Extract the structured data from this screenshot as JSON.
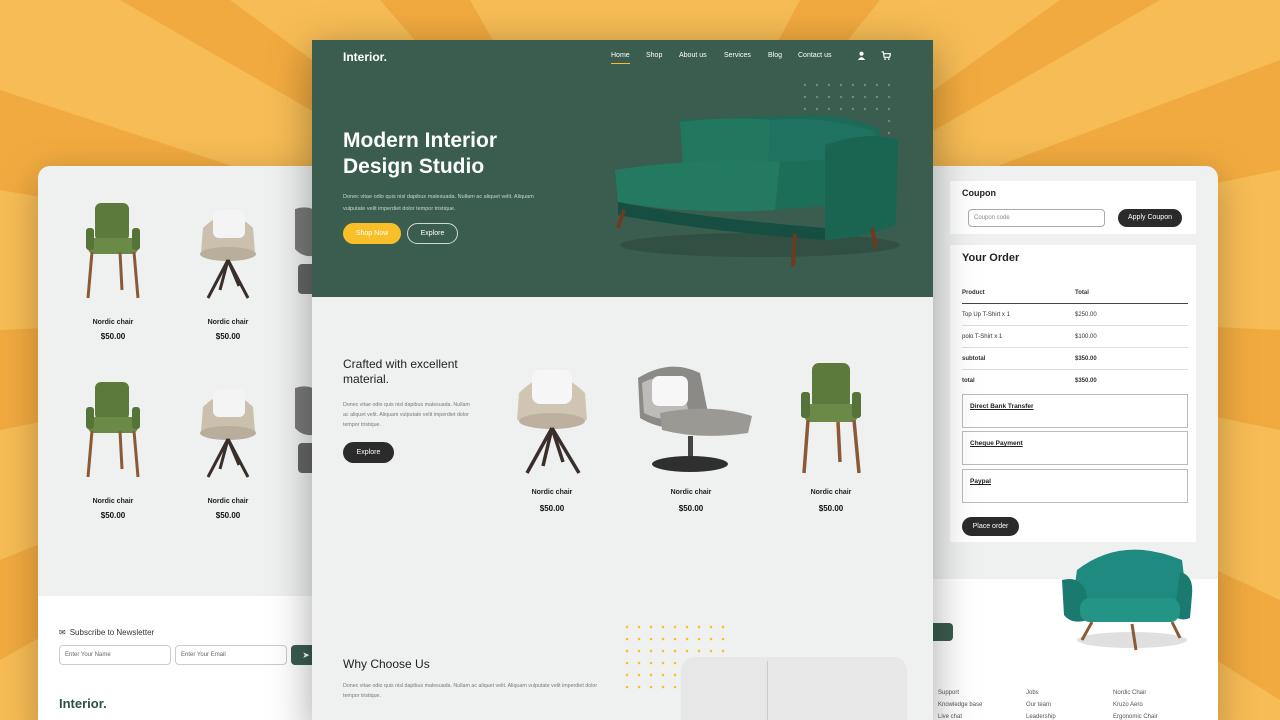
{
  "center": {
    "brand": "Interior.",
    "nav": [
      "Home",
      "Shop",
      "About us",
      "Services",
      "Blog",
      "Contact us"
    ],
    "nav_icons": [
      "user-icon",
      "cart-icon"
    ],
    "hero": {
      "title_line1": "Modern Interior",
      "title_line2": "Design Studio",
      "description_line1": "Donec vitae odio quis nisl dapibus malesuada. Nullam ac aliquet velit. Aliquam",
      "description_line2": "vulputate velit imperdiet dolor tempor tristique.",
      "primary_button": "Shop Now",
      "secondary_button": "Explore"
    },
    "crafted": {
      "title": "Crafted with excellent material.",
      "description": "Donec vitae odio quis nisl dapibus malesuada. Nullam ac aliquet velit. Aliquam vulputate velit imperdiet dolor tempor tristique.",
      "button": "Explore",
      "products": [
        {
          "name": "Nordic chair",
          "price": "$50.00"
        },
        {
          "name": "Nordic chair",
          "price": "$50.00"
        },
        {
          "name": "Nordic chair",
          "price": "$50.00"
        }
      ]
    },
    "why": {
      "title": "Why Choose Us",
      "description": "Donec vitae odio quis nisl dapibus malesuada. Nullam ac aliquet velit. Aliquam vulputate velit imperdiet dolor tempor tristique."
    }
  },
  "left": {
    "products": [
      {
        "name": "Nordic chair",
        "price": "$50.00"
      },
      {
        "name": "Nordic chair",
        "price": "$50.00"
      },
      {
        "name": "Nordic chair",
        "price": "$50.00"
      },
      {
        "name": "Nordic chair",
        "price": "$50.00"
      }
    ],
    "newsletter": {
      "title": "Subscribe to Newsletter",
      "name_placeholder": "Enter Your Name",
      "email_placeholder": "Enter Your Email"
    },
    "brand": "Interior."
  },
  "right": {
    "coupon": {
      "title": "Coupon",
      "placeholder": "Coupon code",
      "button": "Apply Coupon"
    },
    "order": {
      "title": "Your Order",
      "headers": [
        "Product",
        "Total"
      ],
      "rows": [
        {
          "product": "Top Up T-Shirt x 1",
          "total": "$250.00"
        },
        {
          "product": "polo T-Shirt x 1",
          "total": "$100.00"
        },
        {
          "product": "subtotal",
          "total": "$350.00"
        },
        {
          "product": "total",
          "total": "$350.00"
        }
      ],
      "payments": [
        "Direct Bank Transfer",
        "Cheque Payment",
        "Paypal"
      ],
      "place_order": "Place order"
    },
    "footer_links": {
      "col1": [
        "Support",
        "Knowledge base",
        "Live chat"
      ],
      "col2": [
        "Jobs",
        "Our team",
        "Leadership"
      ],
      "col3": [
        "Nordic Chair",
        "Kruzo Aero",
        "Ergonomic Chair"
      ]
    }
  },
  "colors": {
    "background": "#f7bc55",
    "primary_green": "#3b5d50",
    "accent_yellow": "#f9bf29",
    "dark_button": "#2b2b2b"
  }
}
